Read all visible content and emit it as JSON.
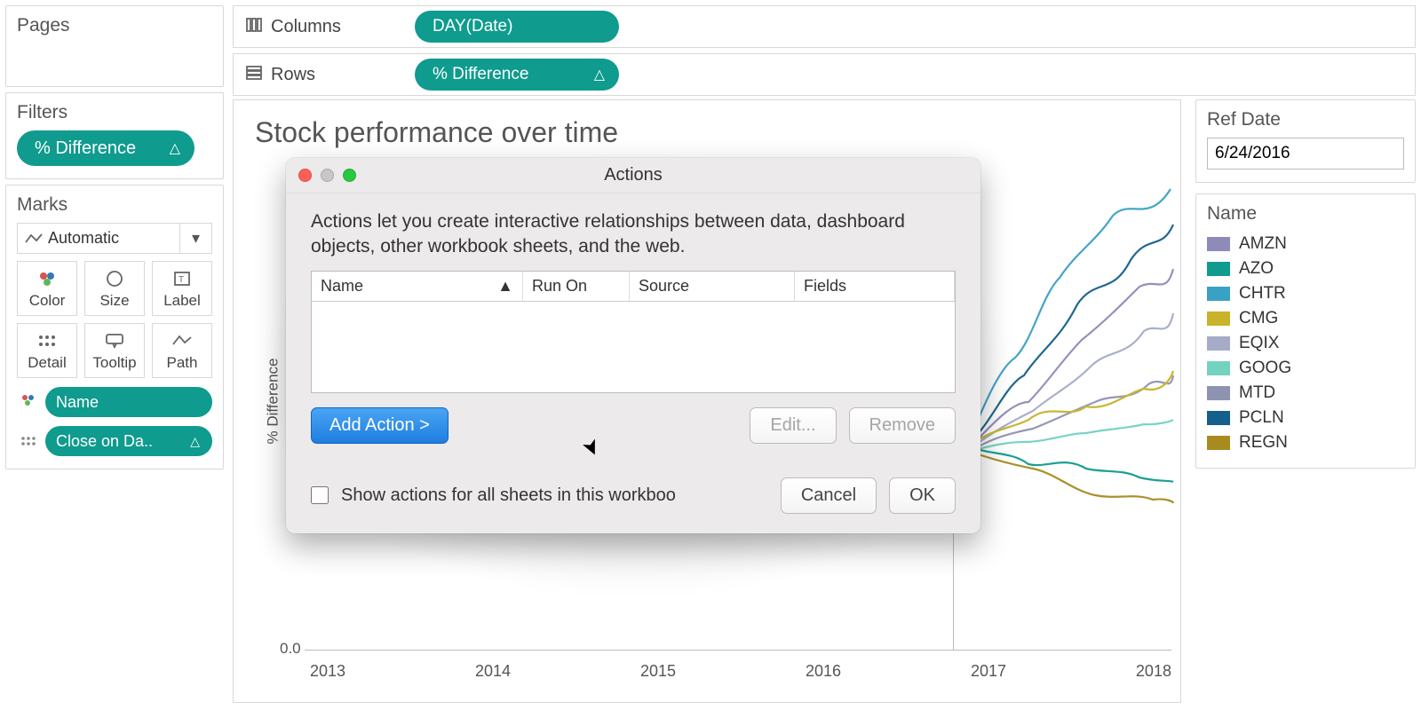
{
  "leftcol": {
    "pages_title": "Pages",
    "filters_title": "Filters",
    "filters_pill": "% Difference",
    "marks_title": "Marks",
    "mark_type": "Automatic",
    "cells": {
      "color": "Color",
      "size": "Size",
      "label": "Label",
      "detail": "Detail",
      "tooltip": "Tooltip",
      "path": "Path"
    },
    "mark_pills": {
      "name": "Name",
      "close": "Close on Da.."
    }
  },
  "shelves": {
    "columns_label": "Columns",
    "columns_pill": "DAY(Date)",
    "rows_label": "Rows",
    "rows_pill": "% Difference"
  },
  "viz": {
    "title": "Stock performance over time",
    "y_axis_label": "% Difference",
    "y_tick_zero": "0.0",
    "x_ticks": [
      "2013",
      "2014",
      "2015",
      "2016",
      "2017",
      "2018"
    ]
  },
  "rightcol": {
    "ref_date_label": "Ref Date",
    "ref_date_value": "6/24/2016",
    "legend_title": "Name",
    "legend": [
      {
        "label": "AMZN",
        "color": "#8e8bb9"
      },
      {
        "label": "AZO",
        "color": "#0f9b8e"
      },
      {
        "label": "CHTR",
        "color": "#3aa1c6"
      },
      {
        "label": "CMG",
        "color": "#c8b32a"
      },
      {
        "label": "EQIX",
        "color": "#a6abc8"
      },
      {
        "label": "GOOG",
        "color": "#73d2c0"
      },
      {
        "label": "MTD",
        "color": "#8f93b2"
      },
      {
        "label": "PCLN",
        "color": "#155f8c"
      },
      {
        "label": "REGN",
        "color": "#a78b1f"
      }
    ]
  },
  "dialog": {
    "title": "Actions",
    "description": "Actions let you create interactive relationships between data, dashboard objects, other workbook sheets, and the web.",
    "cols": {
      "name": "Name",
      "run": "Run On",
      "source": "Source",
      "fields": "Fields"
    },
    "add_btn": "Add Action >",
    "edit_btn": "Edit...",
    "remove_btn": "Remove",
    "show_all_label": "Show actions for all sheets in this workboo",
    "cancel_btn": "Cancel",
    "ok_btn": "OK"
  },
  "chart_data": {
    "type": "line",
    "title": "Stock performance over time",
    "xlabel": "",
    "ylabel": "% Difference",
    "x_range": [
      2012.5,
      2018.2
    ],
    "reference_line_x": 2016.48,
    "y_zero_visible": true,
    "series": [
      {
        "name": "AMZN",
        "color": "#8e8bb9"
      },
      {
        "name": "AZO",
        "color": "#0f9b8e"
      },
      {
        "name": "CHTR",
        "color": "#3aa1c6"
      },
      {
        "name": "CMG",
        "color": "#c8b32a"
      },
      {
        "name": "EQIX",
        "color": "#a6abc8"
      },
      {
        "name": "GOOG",
        "color": "#73d2c0"
      },
      {
        "name": "MTD",
        "color": "#8f93b2"
      },
      {
        "name": "PCLN",
        "color": "#155f8c"
      },
      {
        "name": "REGN",
        "color": "#a78b1f"
      }
    ],
    "note": "Line values obscured by dialog; only right-hand portion visible. All series diverge from ~0 near ref date; most trend positive into 2017-2018, CMG and REGN trend lower."
  }
}
